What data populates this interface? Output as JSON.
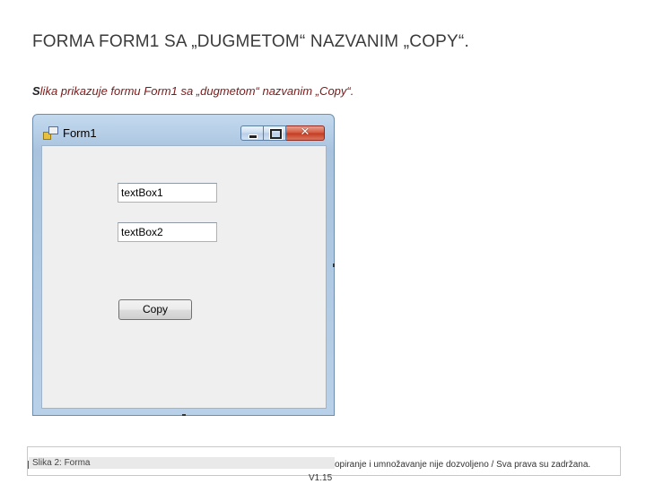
{
  "slide": {
    "title": "FORMA FORM1 SA „DUGMETOM“ NAZVANIM „COPY“.",
    "caption_first_letter": "S",
    "caption_rest": "lika prikazuje formu Form1 sa „dugmetom“ nazvanim „Copy“."
  },
  "window": {
    "title": "Form1",
    "icon": "windows-form-icon",
    "controls": {
      "minimize_icon": "minimize-icon",
      "maximize_icon": "maximize-icon",
      "close_icon": "close-icon",
      "close_glyph": "✕"
    },
    "textbox1_value": "textBox1",
    "textbox2_value": "textBox2",
    "copy_button_label": "Copy",
    "colors": {
      "frame": "#b4cde6",
      "client": "#efefef",
      "close": "#c43a20"
    }
  },
  "footer": {
    "caption": "Slika 2: Forma",
    "rights": "opiranje i umnožavanje nije dozvoljeno / Sva prava su zadržana.",
    "version": "V1.15"
  }
}
